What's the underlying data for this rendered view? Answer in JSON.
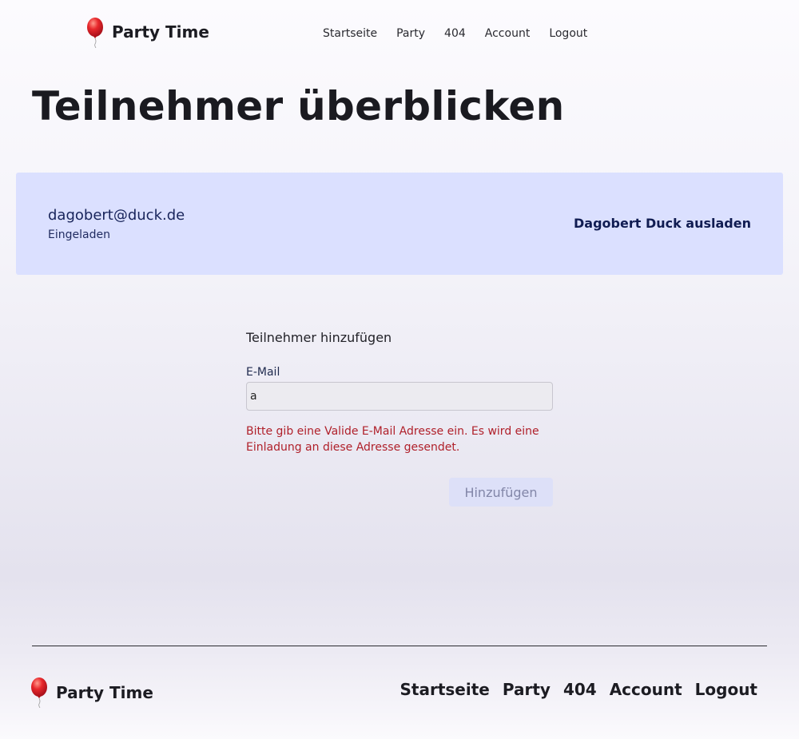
{
  "header": {
    "brand": "Party Time",
    "nav": [
      "Startseite",
      "Party",
      "404",
      "Account",
      "Logout"
    ]
  },
  "page": {
    "title": "Teilnehmer überblicken"
  },
  "participants": [
    {
      "email": "dagobert@duck.de",
      "status": "Eingeladen",
      "action": "Dagobert Duck ausladen"
    }
  ],
  "form": {
    "title": "Teilnehmer hinzufügen",
    "email_label": "E-Mail",
    "email_value": "a",
    "error": "Bitte gib eine Valide E-Mail Adresse ein. Es wird eine Einladung an diese Adresse gesendet.",
    "submit_label": "Hinzufügen"
  },
  "footer": {
    "brand": "Party Time",
    "nav": [
      "Startseite",
      "Party",
      "404",
      "Account",
      "Logout"
    ]
  },
  "colors": {
    "card_bg": "#dbe0ff",
    "error": "#b0202a",
    "balloon": "#e8282c"
  },
  "icons": {
    "logo": "balloon-icon"
  }
}
